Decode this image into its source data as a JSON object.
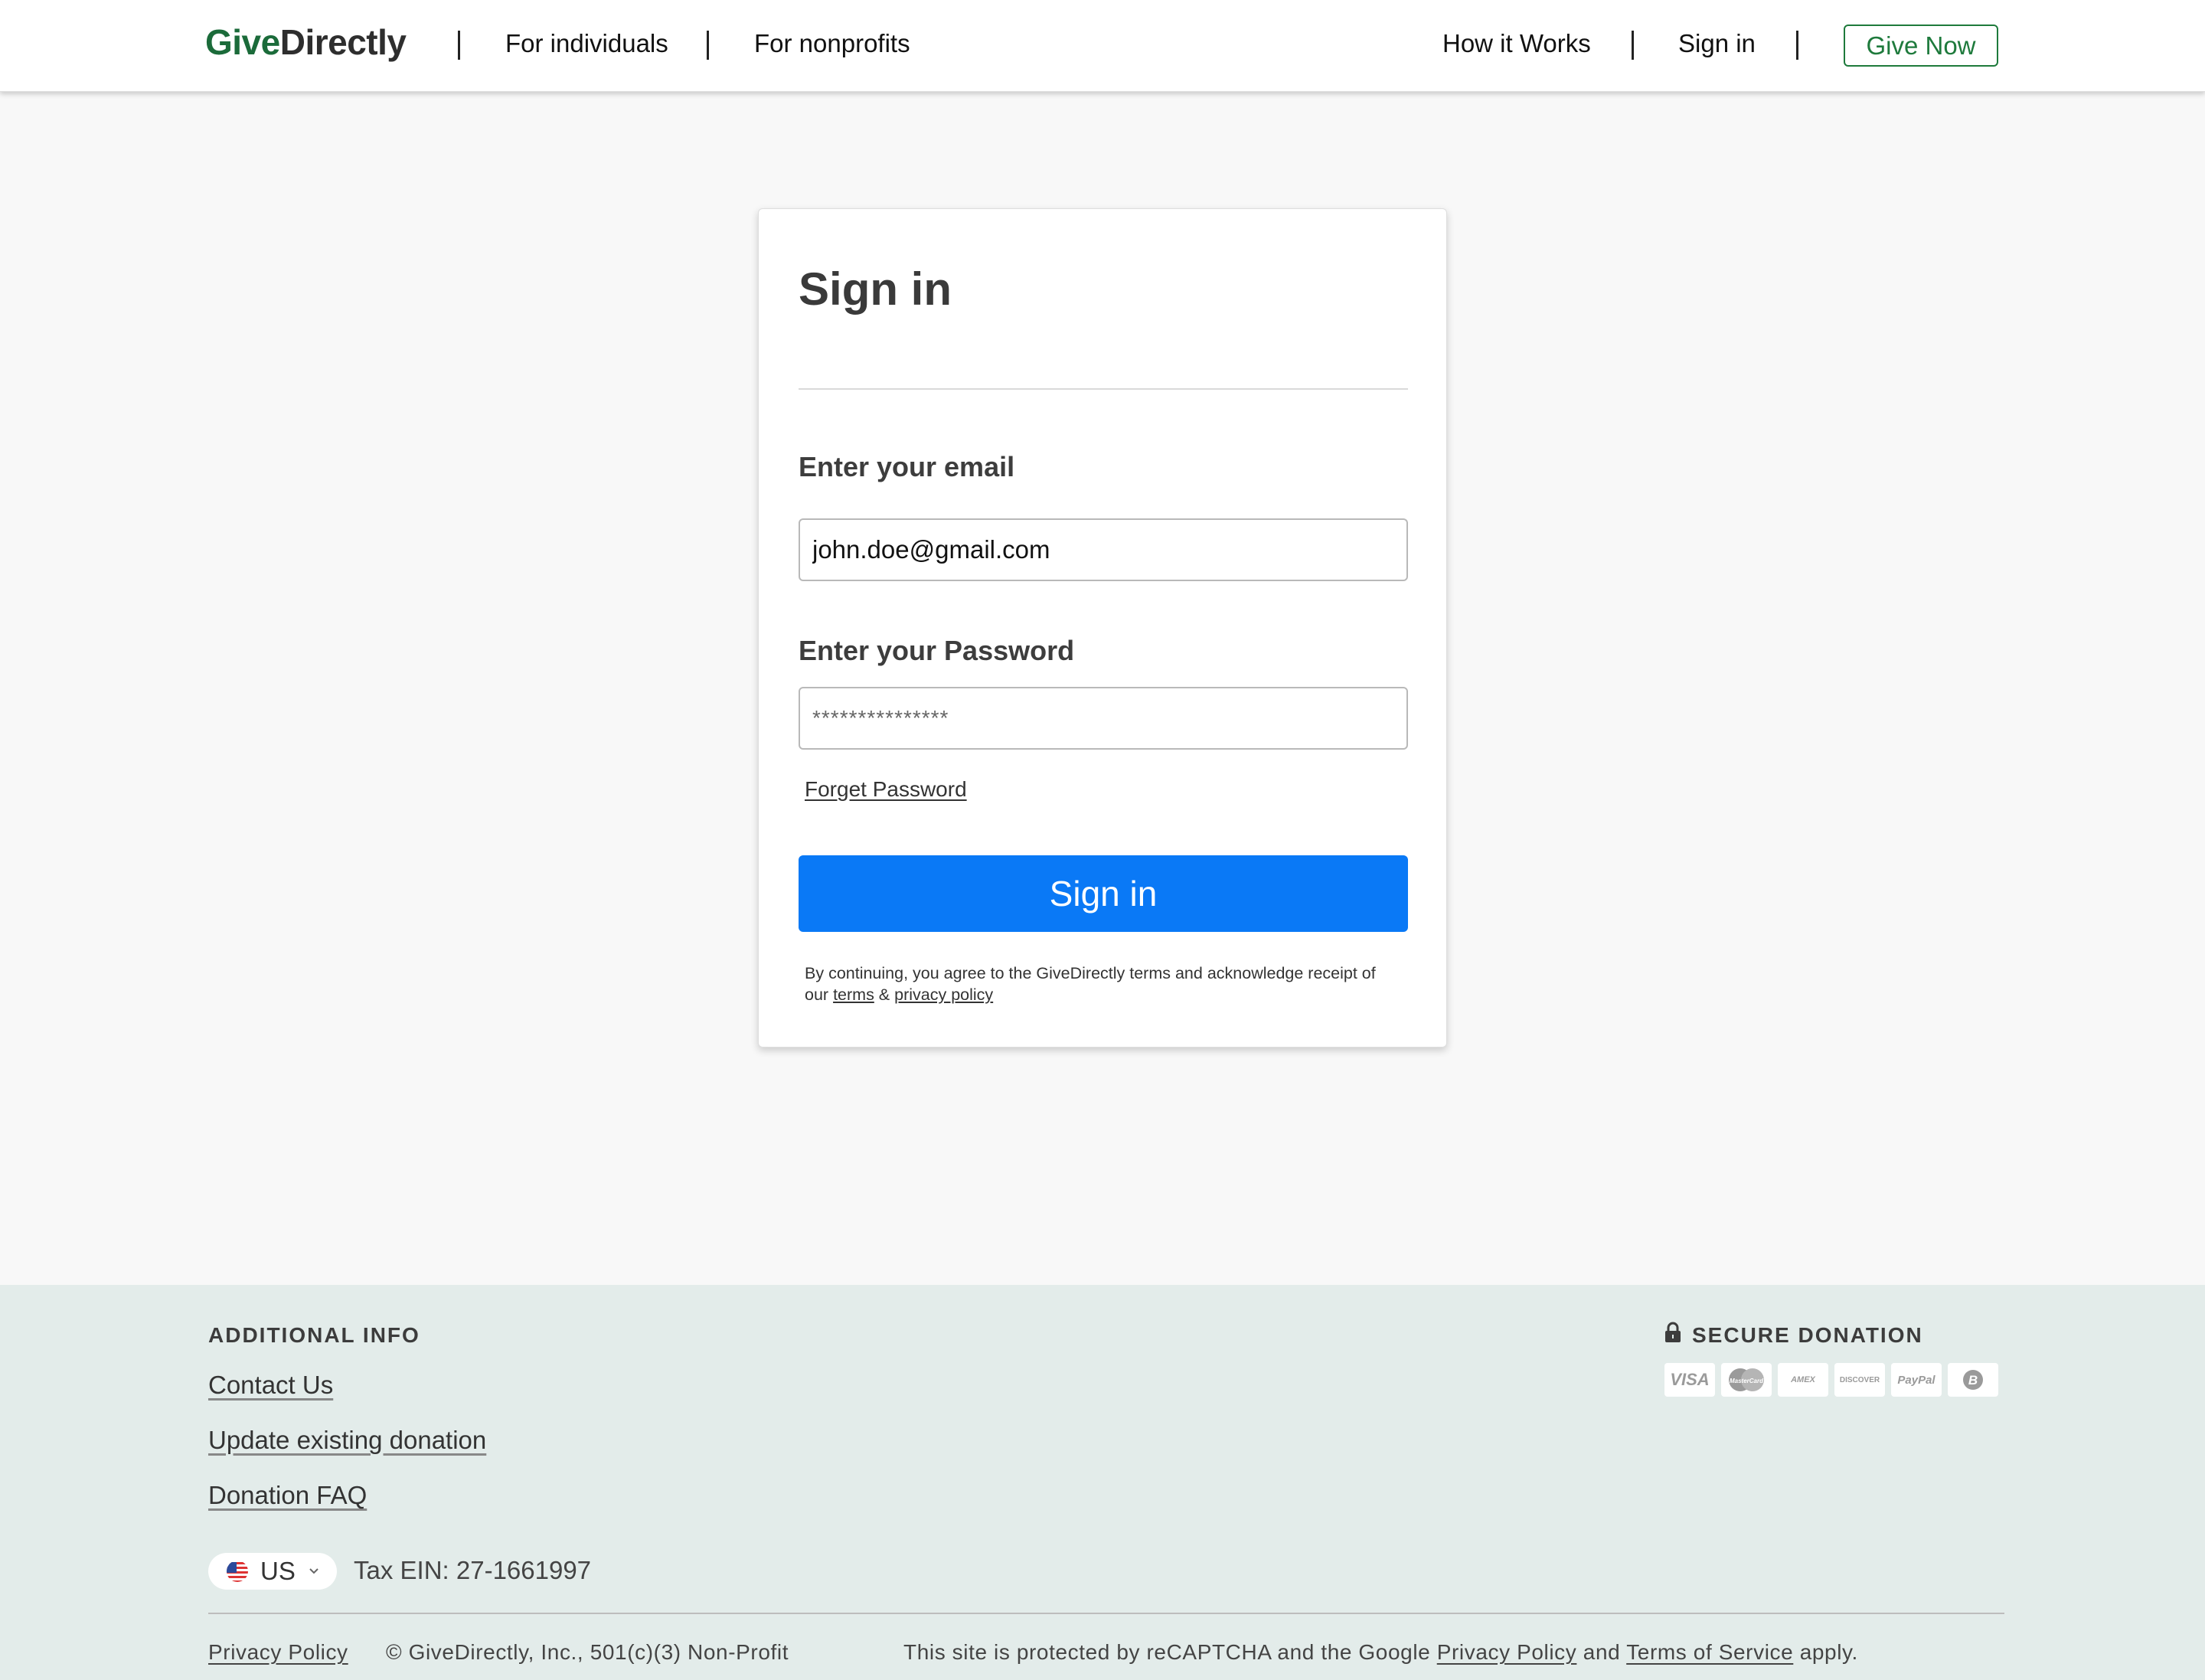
{
  "header": {
    "logo_give": "Give",
    "logo_directly": "Directly",
    "nav_individuals": "For individuals",
    "nav_nonprofits": "For nonprofits",
    "nav_how": "How it Works",
    "nav_signin": "Sign in",
    "give_now": "Give Now"
  },
  "form": {
    "title": "Sign in",
    "email_label": "Enter your email",
    "email_value": "john.doe@gmail.com",
    "password_label": "Enter your Password",
    "password_value": "***************",
    "forgot": "Forget Password",
    "submit": "Sign in",
    "legal_prefix": "By continuing, you agree to the GiveDirectly terms and acknowledge receipt of our",
    "legal_terms": "terms",
    "legal_amp": "&",
    "legal_privacy": "privacy policy"
  },
  "footer": {
    "additional_info": "ADDITIONAL INFO",
    "contact": "Contact Us",
    "update_donation": "Update existing donation",
    "faq": "Donation FAQ",
    "secure_donation": "SECURE DONATION",
    "payment_methods": [
      "VISA",
      "MasterCard",
      "AMEX",
      "DISCOVER",
      "PayPal",
      "B"
    ],
    "country": "US",
    "tax": "Tax EIN: 27-1661997",
    "privacy_policy": "Privacy Policy",
    "copyright": "© GiveDirectly, Inc., 501(c)(3) Non-Profit",
    "recaptcha_prefix": "This site is protected by reCAPTCHA and the Google",
    "recaptcha_privacy": "Privacy Policy",
    "recaptcha_and": "and",
    "recaptcha_terms": "Terms of Service",
    "recaptcha_suffix": "apply."
  },
  "colors": {
    "brand_green": "#1b6b3a",
    "button_blue": "#0a79f6",
    "footer_bg": "#e3ecea"
  }
}
